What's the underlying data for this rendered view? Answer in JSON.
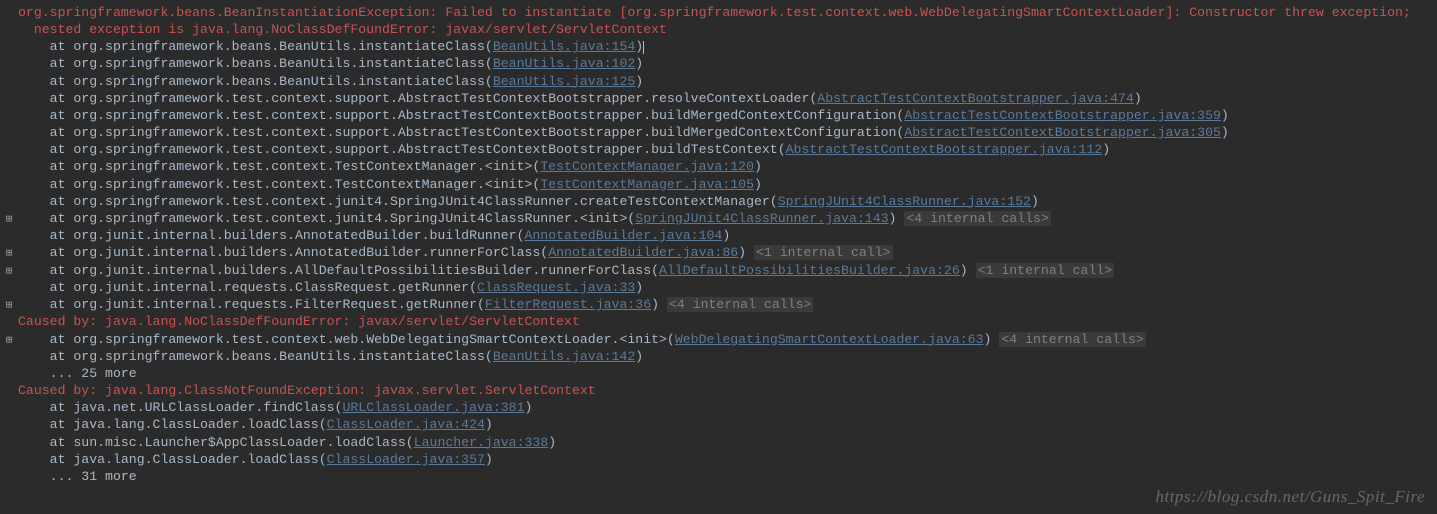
{
  "lines": [
    {
      "expand": false,
      "segs": [
        {
          "c": "err",
          "t": "org.springframework.beans.BeanInstantiationException: Failed to instantiate [org.springframework.test.context.web.WebDelegatingSmartContextLoader]: Constructor threw exception;"
        }
      ]
    },
    {
      "expand": false,
      "segs": [
        {
          "c": "err",
          "t": "  nested exception is java.lang.NoClassDefFoundError: javax/servlet/ServletContext"
        }
      ]
    },
    {
      "expand": false,
      "segs": [
        {
          "c": "ok",
          "t": ""
        }
      ]
    },
    {
      "expand": false,
      "segs": [
        {
          "c": "ok",
          "t": "    at org.springframework.beans.BeanUtils.instantiateClass("
        },
        {
          "c": "lnk",
          "t": "BeanUtils.java:154"
        },
        {
          "c": "ok",
          "t": ")"
        },
        {
          "cursor": true
        }
      ]
    },
    {
      "expand": false,
      "segs": [
        {
          "c": "ok",
          "t": "    at org.springframework.beans.BeanUtils.instantiateClass("
        },
        {
          "c": "lnk",
          "t": "BeanUtils.java:102"
        },
        {
          "c": "ok",
          "t": ")"
        }
      ]
    },
    {
      "expand": false,
      "segs": [
        {
          "c": "ok",
          "t": "    at org.springframework.beans.BeanUtils.instantiateClass("
        },
        {
          "c": "lnk",
          "t": "BeanUtils.java:125"
        },
        {
          "c": "ok",
          "t": ")"
        }
      ]
    },
    {
      "expand": false,
      "segs": [
        {
          "c": "ok",
          "t": "    at org.springframework.test.context.support.AbstractTestContextBootstrapper.resolveContextLoader("
        },
        {
          "c": "lnk",
          "t": "AbstractTestContextBootstrapper.java:474"
        },
        {
          "c": "ok",
          "t": ")"
        }
      ]
    },
    {
      "expand": false,
      "segs": [
        {
          "c": "ok",
          "t": "    at org.springframework.test.context.support.AbstractTestContextBootstrapper.buildMergedContextConfiguration("
        },
        {
          "c": "lnk",
          "t": "AbstractTestContextBootstrapper.java:359"
        },
        {
          "c": "ok",
          "t": ")"
        }
      ]
    },
    {
      "expand": false,
      "segs": [
        {
          "c": "ok",
          "t": "    at org.springframework.test.context.support.AbstractTestContextBootstrapper.buildMergedContextConfiguration("
        },
        {
          "c": "lnk",
          "t": "AbstractTestContextBootstrapper.java:305"
        },
        {
          "c": "ok",
          "t": ")"
        }
      ]
    },
    {
      "expand": false,
      "segs": [
        {
          "c": "ok",
          "t": "    at org.springframework.test.context.support.AbstractTestContextBootstrapper.buildTestContext("
        },
        {
          "c": "lnk",
          "t": "AbstractTestContextBootstrapper.java:112"
        },
        {
          "c": "ok",
          "t": ")"
        }
      ]
    },
    {
      "expand": false,
      "segs": [
        {
          "c": "ok",
          "t": "    at org.springframework.test.context.TestContextManager.<init>("
        },
        {
          "c": "lnk",
          "t": "TestContextManager.java:120"
        },
        {
          "c": "ok",
          "t": ")"
        }
      ]
    },
    {
      "expand": false,
      "segs": [
        {
          "c": "ok",
          "t": "    at org.springframework.test.context.TestContextManager.<init>("
        },
        {
          "c": "lnk",
          "t": "TestContextManager.java:105"
        },
        {
          "c": "ok",
          "t": ")"
        }
      ]
    },
    {
      "expand": false,
      "segs": [
        {
          "c": "ok",
          "t": "    at org.springframework.test.context.junit4.SpringJUnit4ClassRunner.createTestContextManager("
        },
        {
          "c": "lnk",
          "t": "SpringJUnit4ClassRunner.java:152"
        },
        {
          "c": "ok",
          "t": ")"
        }
      ]
    },
    {
      "expand": true,
      "segs": [
        {
          "c": "ok",
          "t": "    at org.springframework.test.context.junit4.SpringJUnit4ClassRunner.<init>("
        },
        {
          "c": "lnk",
          "t": "SpringJUnit4ClassRunner.java:143"
        },
        {
          "c": "ok",
          "t": ") "
        },
        {
          "c": "grey-bg",
          "t": "<4 internal calls>"
        }
      ]
    },
    {
      "expand": false,
      "segs": [
        {
          "c": "ok",
          "t": "    at org.junit.internal.builders.AnnotatedBuilder.buildRunner("
        },
        {
          "c": "lnk",
          "t": "AnnotatedBuilder.java:104"
        },
        {
          "c": "ok",
          "t": ")"
        }
      ]
    },
    {
      "expand": true,
      "segs": [
        {
          "c": "ok",
          "t": "    at org.junit.internal.builders.AnnotatedBuilder.runnerForClass("
        },
        {
          "c": "lnk",
          "t": "AnnotatedBuilder.java:86"
        },
        {
          "c": "ok",
          "t": ") "
        },
        {
          "c": "grey-bg",
          "t": "<1 internal call>"
        }
      ]
    },
    {
      "expand": true,
      "segs": [
        {
          "c": "ok",
          "t": "    at org.junit.internal.builders.AllDefaultPossibilitiesBuilder.runnerForClass("
        },
        {
          "c": "lnk",
          "t": "AllDefaultPossibilitiesBuilder.java:26"
        },
        {
          "c": "ok",
          "t": ") "
        },
        {
          "c": "grey-bg",
          "t": "<1 internal call>"
        }
      ]
    },
    {
      "expand": false,
      "segs": [
        {
          "c": "ok",
          "t": "    at org.junit.internal.requests.ClassRequest.getRunner("
        },
        {
          "c": "lnk",
          "t": "ClassRequest.java:33"
        },
        {
          "c": "ok",
          "t": ")"
        }
      ]
    },
    {
      "expand": true,
      "segs": [
        {
          "c": "ok",
          "t": "    at org.junit.internal.requests.FilterRequest.getRunner("
        },
        {
          "c": "lnk",
          "t": "FilterRequest.java:36"
        },
        {
          "c": "ok",
          "t": ") "
        },
        {
          "c": "grey-bg",
          "t": "<4 internal calls>"
        }
      ]
    },
    {
      "expand": false,
      "segs": [
        {
          "c": "err",
          "t": "Caused by: java.lang.NoClassDefFoundError: javax/servlet/ServletContext"
        }
      ]
    },
    {
      "expand": true,
      "segs": [
        {
          "c": "ok",
          "t": "    at org.springframework.test.context.web.WebDelegatingSmartContextLoader.<init>("
        },
        {
          "c": "lnk",
          "t": "WebDelegatingSmartContextLoader.java:63"
        },
        {
          "c": "ok",
          "t": ") "
        },
        {
          "c": "grey-bg",
          "t": "<4 internal calls>"
        }
      ]
    },
    {
      "expand": false,
      "segs": [
        {
          "c": "ok",
          "t": "    at org.springframework.beans.BeanUtils.instantiateClass("
        },
        {
          "c": "lnk",
          "t": "BeanUtils.java:142"
        },
        {
          "c": "ok",
          "t": ")"
        }
      ]
    },
    {
      "expand": false,
      "segs": [
        {
          "c": "ok",
          "t": "    ... 25 more"
        }
      ]
    },
    {
      "expand": false,
      "segs": [
        {
          "c": "err",
          "t": "Caused by: java.lang.ClassNotFoundException: javax.servlet.ServletContext"
        }
      ]
    },
    {
      "expand": false,
      "segs": [
        {
          "c": "ok",
          "t": "    at java.net.URLClassLoader.findClass("
        },
        {
          "c": "lnk",
          "t": "URLClassLoader.java:381"
        },
        {
          "c": "ok",
          "t": ")"
        }
      ]
    },
    {
      "expand": false,
      "segs": [
        {
          "c": "ok",
          "t": "    at java.lang.ClassLoader.loadClass("
        },
        {
          "c": "lnk",
          "t": "ClassLoader.java:424"
        },
        {
          "c": "ok",
          "t": ")"
        }
      ]
    },
    {
      "expand": false,
      "segs": [
        {
          "c": "ok",
          "t": "    at sun.misc.Launcher$AppClassLoader.loadClass("
        },
        {
          "c": "lnk",
          "t": "Launcher.java:338"
        },
        {
          "c": "ok",
          "t": ")"
        }
      ]
    },
    {
      "expand": false,
      "segs": [
        {
          "c": "ok",
          "t": "    at java.lang.ClassLoader.loadClass("
        },
        {
          "c": "lnk",
          "t": "ClassLoader.java:357"
        },
        {
          "c": "ok",
          "t": ")"
        }
      ]
    },
    {
      "expand": false,
      "segs": [
        {
          "c": "ok",
          "t": "    ... 31 more"
        }
      ]
    }
  ],
  "watermark": "https://blog.csdn.net/Guns_Spit_Fire"
}
